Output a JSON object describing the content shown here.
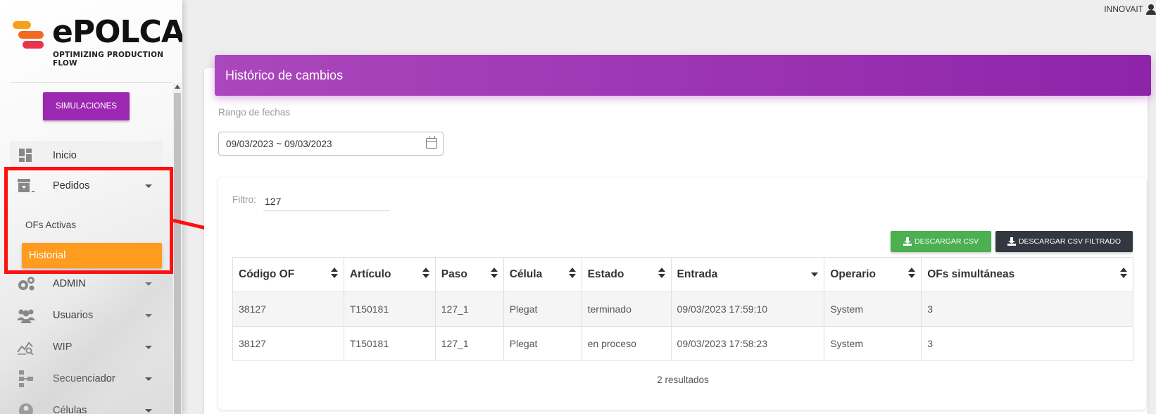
{
  "sidebar": {
    "logo_text": "ePOLCA",
    "logo_sub": "OPTIMIZING PRODUCTION FLOW",
    "simulaciones_label": "SIMULACIONES",
    "items": [
      {
        "label": "Inicio",
        "icon": "dashboard-icon"
      },
      {
        "label": "Pedidos",
        "icon": "archive-icon"
      },
      {
        "label": "ADMIN",
        "icon": "gears-icon"
      },
      {
        "label": "Usuarios",
        "icon": "users-icon"
      },
      {
        "label": "WIP",
        "icon": "chart-search-icon"
      },
      {
        "label": "Secuenciador",
        "icon": "sitemap-icon"
      },
      {
        "label": "Células",
        "icon": "user-circle-icon"
      }
    ],
    "sub_items": [
      {
        "label": "OFs Activas"
      },
      {
        "label": "Historial",
        "active": true
      }
    ]
  },
  "topbar": {
    "user": "INNOVAIT"
  },
  "main": {
    "title": "Histórico de cambios",
    "date_label": "Rango de fechas",
    "date_value": "09/03/2023 ~ 09/03/2023",
    "filter_label": "Filtro:",
    "filter_value": "127",
    "btn_csv": "DESCARGAR CSV",
    "btn_csv_filtered": "DESCARGAR CSV FILTRADO",
    "columns": [
      "Código OF",
      "Artículo",
      "Paso",
      "Célula",
      "Estado",
      "Entrada",
      "Operario",
      "OFs simultáneas"
    ],
    "rows": [
      [
        "38127",
        "T150181",
        "127_1",
        "Plegat",
        "terminado",
        "09/03/2023 17:59:10",
        "System",
        "3"
      ],
      [
        "38127",
        "T150181",
        "127_1",
        "Plegat",
        "en proceso",
        "09/03/2023 17:58:23",
        "System",
        "3"
      ]
    ],
    "results": "2 resultados"
  },
  "colors": {
    "primary": "#9c27b0",
    "active": "#ff9b1f",
    "success": "#4caf50",
    "dark": "#333840",
    "annotation": "#ff1010"
  }
}
